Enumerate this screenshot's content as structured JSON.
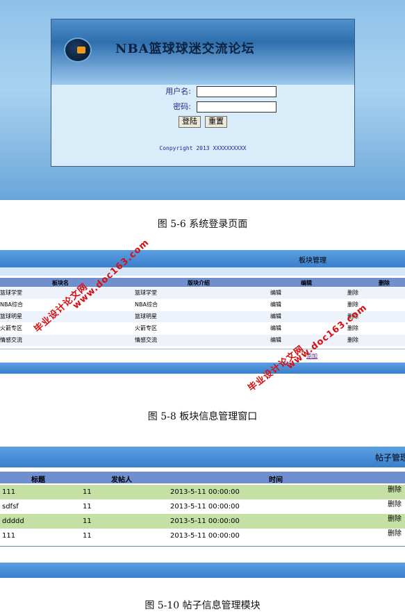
{
  "login": {
    "site_title": "NBA篮球球迷交流论坛",
    "username_label": "用户名:",
    "username_value": "",
    "password_label": "密码:",
    "password_value": "",
    "login_button": "登陆",
    "reset_button": "重置",
    "copyright": "Conpyright 2013 XXXXXXXXXX"
  },
  "captions": {
    "fig1": "图 5-6 系统登录页面",
    "fig2": "图 5-8 板块信息管理窗口",
    "fig3": "图 5-10 帖子信息管理模块"
  },
  "board": {
    "title": "板块管理",
    "headers": [
      "板块名",
      "版块介绍",
      "编辑",
      "删除"
    ],
    "rows": [
      {
        "name": "篮球学堂",
        "intro": "篮球学堂",
        "edit": "编辑",
        "delete": "删除"
      },
      {
        "name": "NBA综合",
        "intro": "NBA综合",
        "edit": "编辑",
        "delete": "删除"
      },
      {
        "name": "篮球明星",
        "intro": "篮球明星",
        "edit": "编辑",
        "delete": "删除"
      },
      {
        "name": "火箭专区",
        "intro": "火箭专区",
        "edit": "编辑",
        "delete": "删除"
      },
      {
        "name": "情感交流",
        "intro": "情感交流",
        "edit": "编辑",
        "delete": "删除"
      }
    ],
    "add_link": "添加"
  },
  "posts": {
    "title": "帖子管理",
    "headers": [
      "标题",
      "发帖人",
      "时间"
    ],
    "rows": [
      {
        "title": "111",
        "author": "11",
        "time": "2013-5-11 00:00:00",
        "delete": "删除"
      },
      {
        "title": "sdfsf",
        "author": "11",
        "time": "2013-5-11 00:00:00",
        "delete": "删除"
      },
      {
        "title": "ddddd",
        "author": "11",
        "time": "2013-5-11 00:00:00",
        "delete": "删除"
      },
      {
        "title": "111",
        "author": "11",
        "time": "2013-5-11 00:00:00",
        "delete": "删除"
      }
    ]
  },
  "watermark": {
    "line1": "毕业设计论文网",
    "line2": "www.doc163.com",
    "color": "#d80f0f"
  }
}
